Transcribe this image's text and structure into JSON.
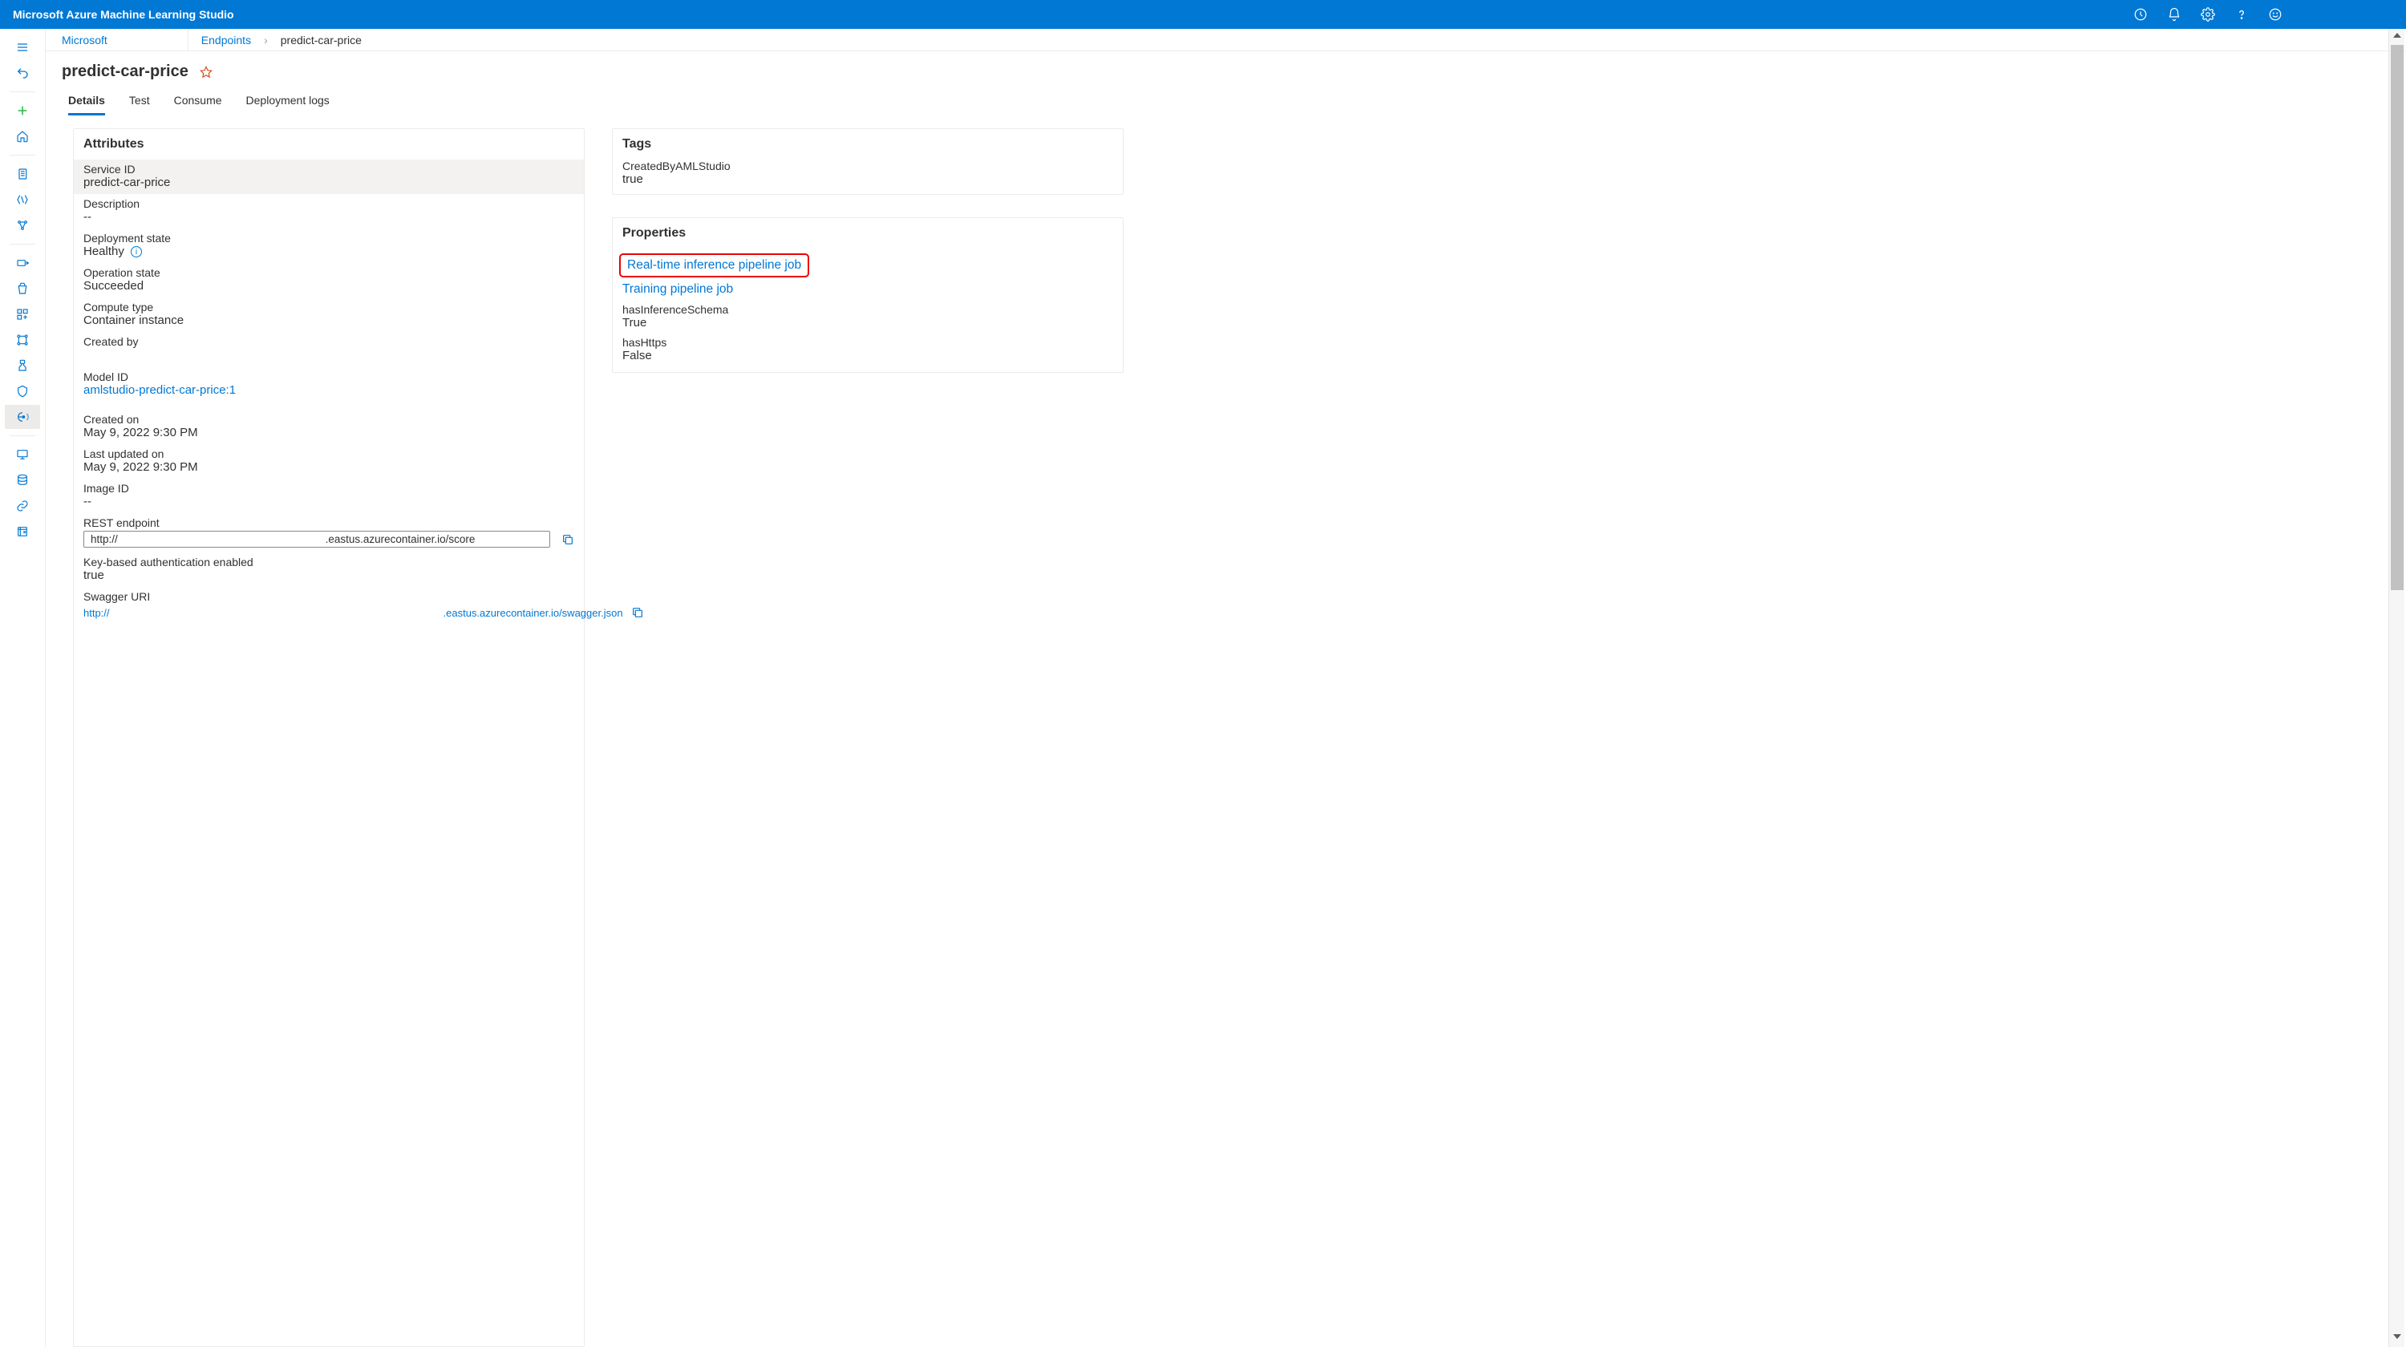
{
  "topbar": {
    "title": "Microsoft Azure Machine Learning Studio"
  },
  "breadcrumb": {
    "workspace": "Microsoft",
    "section": "Endpoints",
    "current": "predict-car-price"
  },
  "page": {
    "title": "predict-car-price"
  },
  "tabs": [
    {
      "label": "Details",
      "active": true
    },
    {
      "label": "Test",
      "active": false
    },
    {
      "label": "Consume",
      "active": false
    },
    {
      "label": "Deployment logs",
      "active": false
    }
  ],
  "attributes": {
    "header": "Attributes",
    "service_id": {
      "label": "Service ID",
      "value": "predict-car-price"
    },
    "description": {
      "label": "Description",
      "value": "--"
    },
    "deployment_state": {
      "label": "Deployment state",
      "value": "Healthy"
    },
    "operation_state": {
      "label": "Operation state",
      "value": "Succeeded"
    },
    "compute_type": {
      "label": "Compute type",
      "value": "Container instance"
    },
    "created_by": {
      "label": "Created by",
      "value": ""
    },
    "model_id": {
      "label": "Model ID",
      "value": "amlstudio-predict-car-price:1"
    },
    "created_on": {
      "label": "Created on",
      "value": "May 9, 2022 9:30 PM"
    },
    "last_updated": {
      "label": "Last updated on",
      "value": "May 9, 2022 9:30 PM"
    },
    "image_id": {
      "label": "Image ID",
      "value": "--"
    },
    "rest_endpoint": {
      "label": "REST endpoint",
      "value": "http://                                                                     .eastus.azurecontainer.io/score"
    },
    "key_auth": {
      "label": "Key-based authentication enabled",
      "value": "true"
    },
    "swagger_uri": {
      "label": "Swagger URI",
      "prefix": "http://",
      "suffix": ".eastus.azurecontainer.io/swagger.json"
    }
  },
  "tags": {
    "header": "Tags",
    "items": [
      {
        "key": "CreatedByAMLStudio",
        "value": "true"
      }
    ]
  },
  "properties": {
    "header": "Properties",
    "links": [
      {
        "label": "Real-time inference pipeline job",
        "highlighted": true
      },
      {
        "label": "Training pipeline job",
        "highlighted": false
      }
    ],
    "items": [
      {
        "key": "hasInferenceSchema",
        "value": "True"
      },
      {
        "key": "hasHttps",
        "value": "False"
      }
    ]
  }
}
